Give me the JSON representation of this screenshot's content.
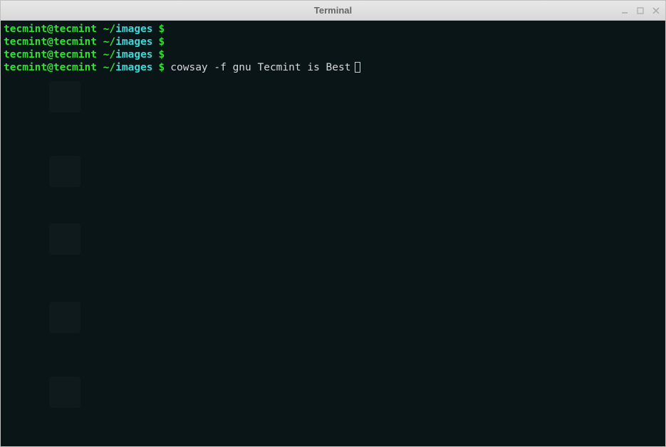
{
  "titlebar": {
    "title": "Terminal"
  },
  "prompt": {
    "user": "tecmint",
    "at": "@",
    "host": "tecmint",
    "tilde": " ~",
    "slash": "/",
    "dir": "images",
    "dollar": "$"
  },
  "lines": {
    "cmd": "cowsay -f gnu Tecmint is Best"
  }
}
